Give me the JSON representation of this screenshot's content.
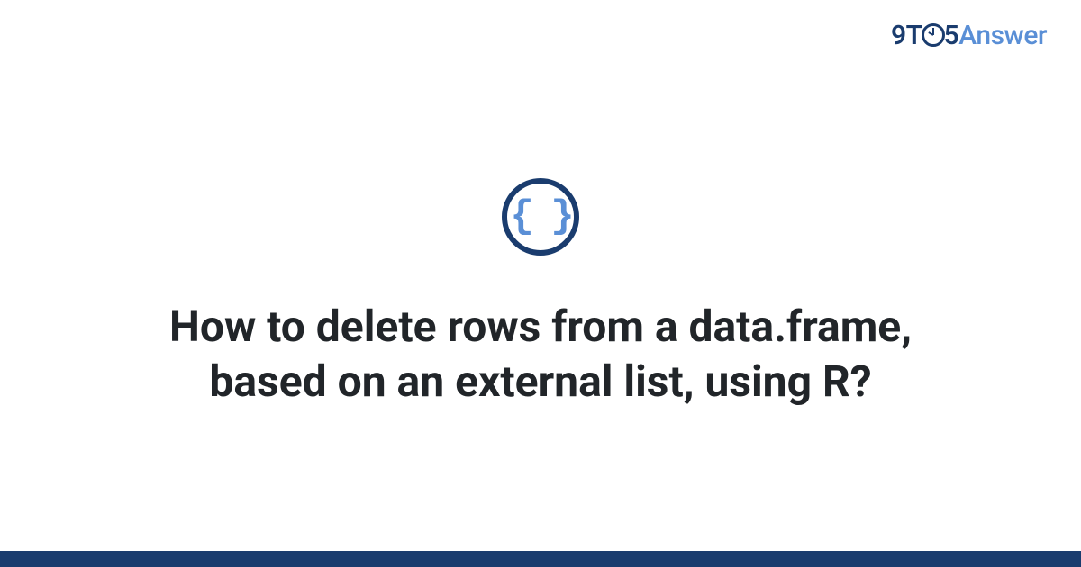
{
  "brand": {
    "part1": "9T",
    "part2": "5",
    "part3": "Answer"
  },
  "category_icon": {
    "glyph": "{ }",
    "name": "code-braces"
  },
  "question": {
    "title": "How to delete rows from a data.frame, based on an external list, using R?"
  },
  "colors": {
    "dark_blue": "#1a3c6e",
    "light_blue": "#5a8fd6",
    "text": "#212529"
  }
}
